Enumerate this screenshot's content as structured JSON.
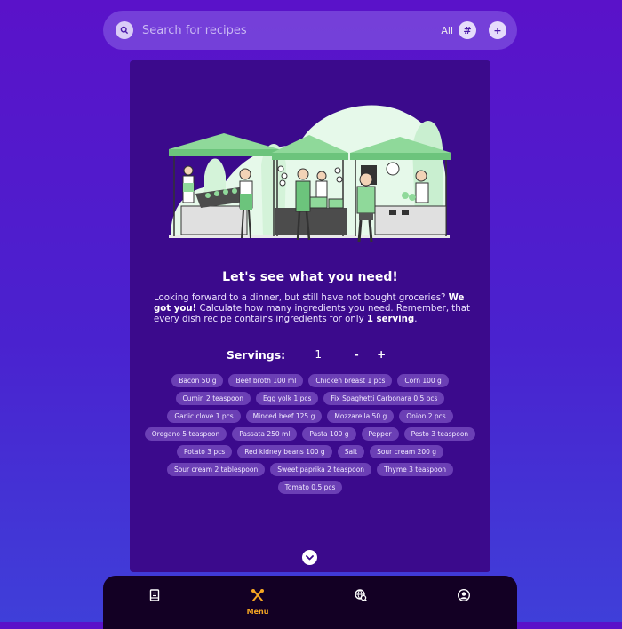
{
  "search": {
    "placeholder": "Search for recipes",
    "filter_label": "All",
    "hash_label": "#",
    "add_label": "+"
  },
  "card": {
    "title": "Let's see what you need!",
    "desc_part1": "Looking forward to a dinner, but still have not bought groceries? ",
    "desc_bold1": "We got you!",
    "desc_part2": " Calculate how many ingredients you need. Remember, that every dish recipe contains ingredients for only ",
    "desc_bold2": "1 serving",
    "desc_end": "."
  },
  "servings": {
    "label": "Servings:",
    "value": "1",
    "minus_label": "-",
    "plus_label": "+"
  },
  "ingredients": [
    "Bacon 50 g",
    "Beef broth 100 ml",
    "Chicken breast 1 pcs",
    "Corn 100 g",
    "Cumin 2 teaspoon",
    "Egg yolk 1 pcs",
    "Fix Spaghetti Carbonara 0.5 pcs",
    "Garlic clove 1 pcs",
    "Minced beef 125 g",
    "Mozzarella 50 g",
    "Onion 2 pcs",
    "Oregano 5 teaspoon",
    "Passata 250 ml",
    "Pasta 100 g",
    "Pepper",
    "Pesto 3 teaspoon",
    "Potato 3 pcs",
    "Red kidney beans 100 g",
    "Salt",
    "Sour cream 200 g",
    "Sour cream 2 tablespoon",
    "Sweet paprika 2 teaspoon",
    "Thyme 3 teaspoon",
    "Tomato 0.5 pcs"
  ],
  "nav": {
    "menu_label": "Menu"
  },
  "icons": {
    "search": "search-icon",
    "scroll": "chevron-down-icon",
    "recipes": "recipe-book-icon",
    "menu": "fork-knife-icon",
    "explore": "globe-search-icon",
    "profile": "user-icon"
  },
  "colors": {
    "accent": "#f5a623",
    "card": "#3b0a8c",
    "chip": "#6b3fb5",
    "market_green": "#8fd99a"
  }
}
